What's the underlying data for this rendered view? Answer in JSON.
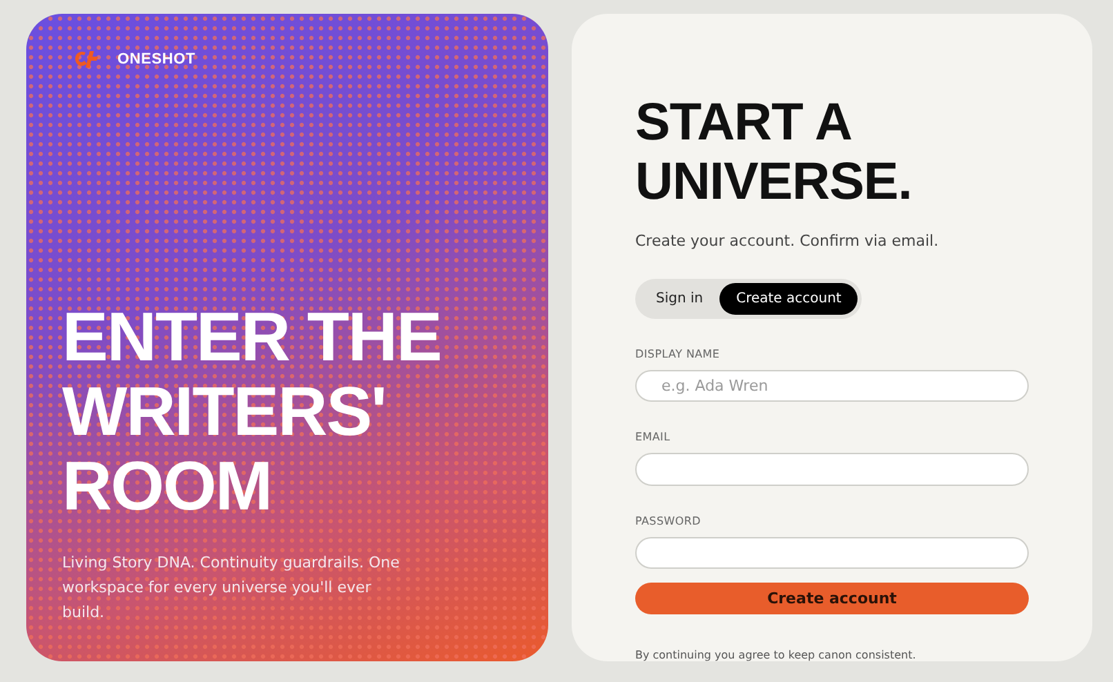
{
  "brand": {
    "name": "ONESHOT"
  },
  "hero": {
    "headline_lines": [
      "ENTER THE",
      "WRITERS'",
      "ROOM"
    ],
    "tagline": "Living Story DNA. Continuity guardrails. One workspace for every universe you'll ever build."
  },
  "form": {
    "title": "START A UNIVERSE.",
    "subtitle": "Create your account. Confirm via email.",
    "tabs": [
      {
        "label": "Sign in",
        "selected": false
      },
      {
        "label": "Create account",
        "selected": true
      }
    ],
    "fields": [
      {
        "label": "DISPLAY NAME",
        "placeholder": "e.g. Ada Wren"
      },
      {
        "label": "EMAIL"
      },
      {
        "label": "PASSWORD"
      }
    ],
    "submit": "Create account",
    "note": "By continuing you agree to keep canon consistent."
  }
}
